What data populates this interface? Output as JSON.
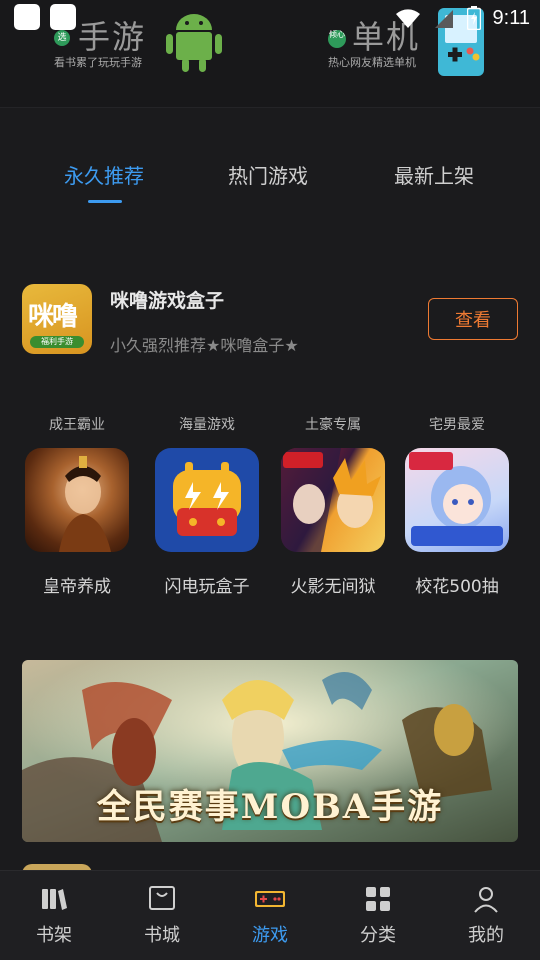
{
  "status_bar": {
    "time": "9:11"
  },
  "top_categories": [
    {
      "badge": "选",
      "title": "手游",
      "subtitle": "看书累了玩玩手游"
    },
    {
      "badge": "倾心",
      "title": "单机",
      "subtitle": "热心网友精选单机"
    }
  ],
  "tabs": [
    {
      "label": "永久推荐",
      "active": true
    },
    {
      "label": "热门游戏",
      "active": false
    },
    {
      "label": "最新上架",
      "active": false
    }
  ],
  "featured_app": {
    "icon_text": "咪噜",
    "icon_ribbon": "福利手游",
    "name": "咪噜游戏盒子",
    "description": "小久强烈推荐★咪噜盒子★",
    "button_label": "查看"
  },
  "games": [
    {
      "tag": "成王霸业",
      "name": "皇帝养成"
    },
    {
      "tag": "海量游戏",
      "name": "闪电玩盒子"
    },
    {
      "tag": "土豪专属",
      "name": "火影无间狱"
    },
    {
      "tag": "宅男最爱",
      "name": "校花500抽"
    }
  ],
  "banner": {
    "text": "全民赛事MOBA手游"
  },
  "bottom_nav": [
    {
      "label": "书架",
      "icon": "bookshelf-icon",
      "active": false
    },
    {
      "label": "书城",
      "icon": "bookstore-icon",
      "active": false
    },
    {
      "label": "游戏",
      "icon": "gamepad-icon",
      "active": true
    },
    {
      "label": "分类",
      "icon": "category-icon",
      "active": false
    },
    {
      "label": "我的",
      "icon": "profile-icon",
      "active": false
    }
  ],
  "colors": {
    "background": "#1b1b1d",
    "accent_blue": "#3d9bf0",
    "accent_orange": "#ee7a33"
  }
}
